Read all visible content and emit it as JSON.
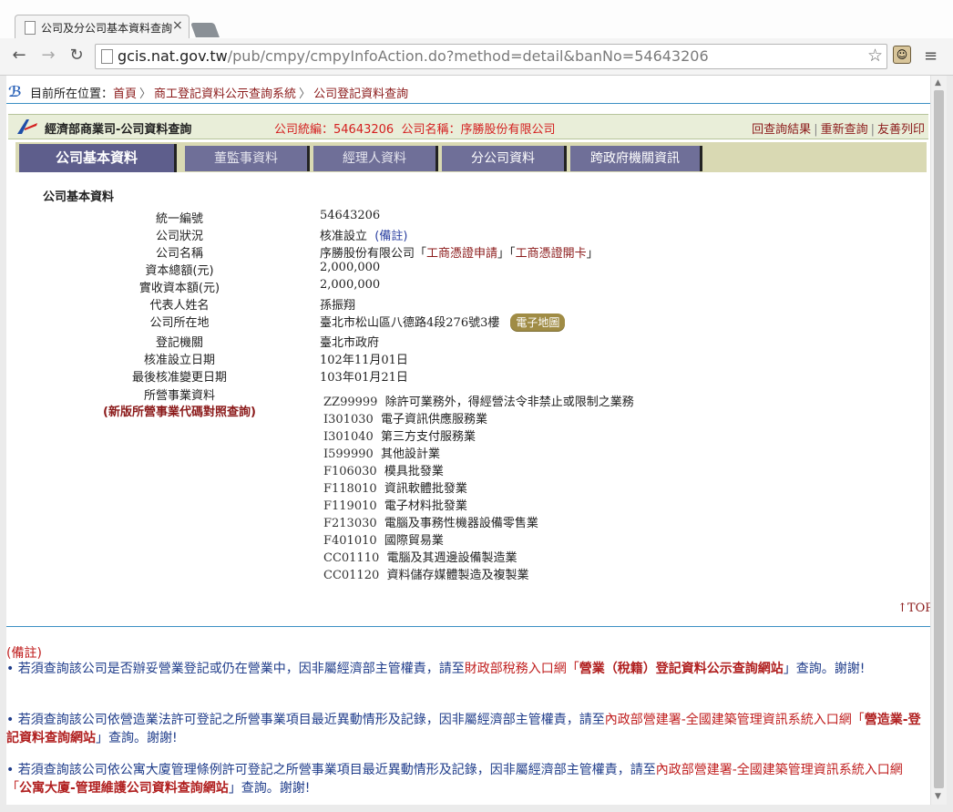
{
  "browser": {
    "tab_title": "公司及分公司基本資料查詢",
    "url_host": "gcis.nat.gov.tw",
    "url_path": "/pub/cmpy/cmpyInfoAction.do?method=detail&banNo=54643206"
  },
  "breadcrumb": {
    "label": "目前所在位置：",
    "items": [
      "首頁",
      "商工登記資料公示查詢系統",
      "公司登記資料查詢"
    ]
  },
  "header": {
    "title": "經濟部商業司-公司資料查詢",
    "company_no_label": "公司統編：",
    "company_no": "54643206",
    "company_name_label": "公司名稱：",
    "company_name": "序勝股份有限公司",
    "links": [
      "回查詢結果",
      "重新查詢",
      "友善列印"
    ]
  },
  "tabs": [
    "公司基本資料",
    "董監事資料",
    "經理人資料",
    "分公司資料",
    "跨政府機關資訊"
  ],
  "section_title": "公司基本資料",
  "fields": {
    "ban_label": "統一編號",
    "ban": "54643206",
    "status_label": "公司狀況",
    "status": "核准設立",
    "status_note": "(備註)",
    "name_label": "公司名稱",
    "name": "序勝股份有限公司",
    "name_link1": "工商憑證申請",
    "name_link2": "工商憑證開卡",
    "capital_label": "資本總額(元)",
    "capital": "2,000,000",
    "paid_label": "實收資本額(元)",
    "paid": "2,000,000",
    "rep_label": "代表人姓名",
    "rep": "孫振翔",
    "addr_label": "公司所在地",
    "addr": "臺北市松山區八德路4段276號3樓",
    "map_button": "電子地圖",
    "reg_label": "登記機關",
    "reg": "臺北市政府",
    "est_label": "核准設立日期",
    "est": "102年11月01日",
    "chg_label": "最後核准變更日期",
    "chg": "103年01月21日",
    "biz_label": "所營事業資料",
    "biz_sub": "(新版所營事業代碼對照查詢)"
  },
  "business": [
    {
      "code": "ZZ99999",
      "desc": "除許可業務外，得經營法令非禁止或限制之業務"
    },
    {
      "code": "I301030",
      "desc": "電子資訊供應服務業"
    },
    {
      "code": "I301040",
      "desc": "第三方支付服務業"
    },
    {
      "code": "I599990",
      "desc": "其他設計業"
    },
    {
      "code": "F106030",
      "desc": "模具批發業"
    },
    {
      "code": "F118010",
      "desc": "資訊軟體批發業"
    },
    {
      "code": "F119010",
      "desc": "電子材料批發業"
    },
    {
      "code": "F213030",
      "desc": "電腦及事務性機器設備零售業"
    },
    {
      "code": "F401010",
      "desc": "國際貿易業"
    },
    {
      "code": "CC01110",
      "desc": "電腦及其週邊設備製造業"
    },
    {
      "code": "CC01120",
      "desc": "資料儲存媒體製造及複製業"
    }
  ],
  "top_link": "↑TOP",
  "notes": {
    "head": "(備註)",
    "n1_a": "• 若須查詢該公司是否辦妥營業登記或仍在營業中，因非屬經濟部主管權責，請至",
    "n1_b": "財政部稅務入口網「",
    "n1_c": "營業（稅籍）登記資料公示查詢網站",
    "n1_d": "」查詢。謝謝!",
    "n2_a": "• 若須查詢該公司依營造業法許可登記之所營事業項目最近異動情形及記錄，因非屬經濟部主管權責，請至",
    "n2_b": "內政部營建署-全國建築管理資訊系統入口網「",
    "n2_c": "營造業-登記資料查詢網站",
    "n2_d": "」查詢。謝謝!",
    "n3_a": "• 若須查詢該公司依公寓大廈管理條例許可登記之所營事業項目最近異動情形及記錄，因非屬經濟部主管權責，請至",
    "n3_b": "內政部營建署-全國建築管理資訊系統入口網「",
    "n3_c": "公寓大廈-管理維護公司資料查詢網站",
    "n3_d": "」查詢。謝謝!"
  }
}
